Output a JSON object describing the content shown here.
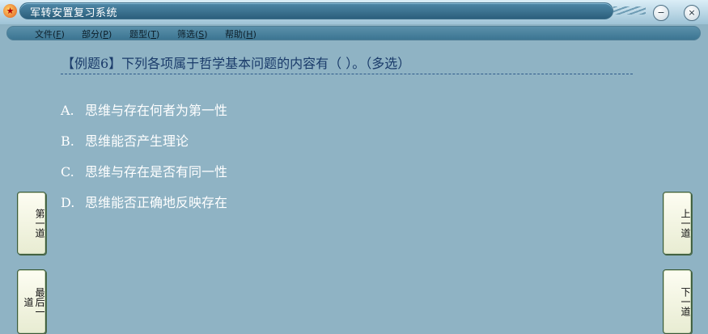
{
  "window": {
    "title": "军转安置复习系统",
    "min_symbol": "−",
    "close_symbol": "×"
  },
  "menu": [
    {
      "label": "文件(",
      "key": "F",
      "close": ")"
    },
    {
      "label": "部分(",
      "key": "P",
      "close": ")"
    },
    {
      "label": "题型(",
      "key": "T",
      "close": ")"
    },
    {
      "label": "筛选(",
      "key": "S",
      "close": ")"
    },
    {
      "label": "帮助(",
      "key": "H",
      "close": ")"
    }
  ],
  "question": {
    "text": "【例题6】下列各项属于哲学基本问题的内容有（  ）。（多选）",
    "options": [
      {
        "letter": "A.",
        "text": "思维与存在何者为第一性"
      },
      {
        "letter": "B.",
        "text": "思维能否产生理论"
      },
      {
        "letter": "C.",
        "text": "思维与存在是否有同一性"
      },
      {
        "letter": "D.",
        "text": "思维能否正确地反映存在"
      }
    ]
  },
  "nav": {
    "first": "第一道",
    "last": "最后一道",
    "prev": "上一道",
    "next": "下一道"
  },
  "icons": {
    "app": "star-emblem-icon"
  }
}
